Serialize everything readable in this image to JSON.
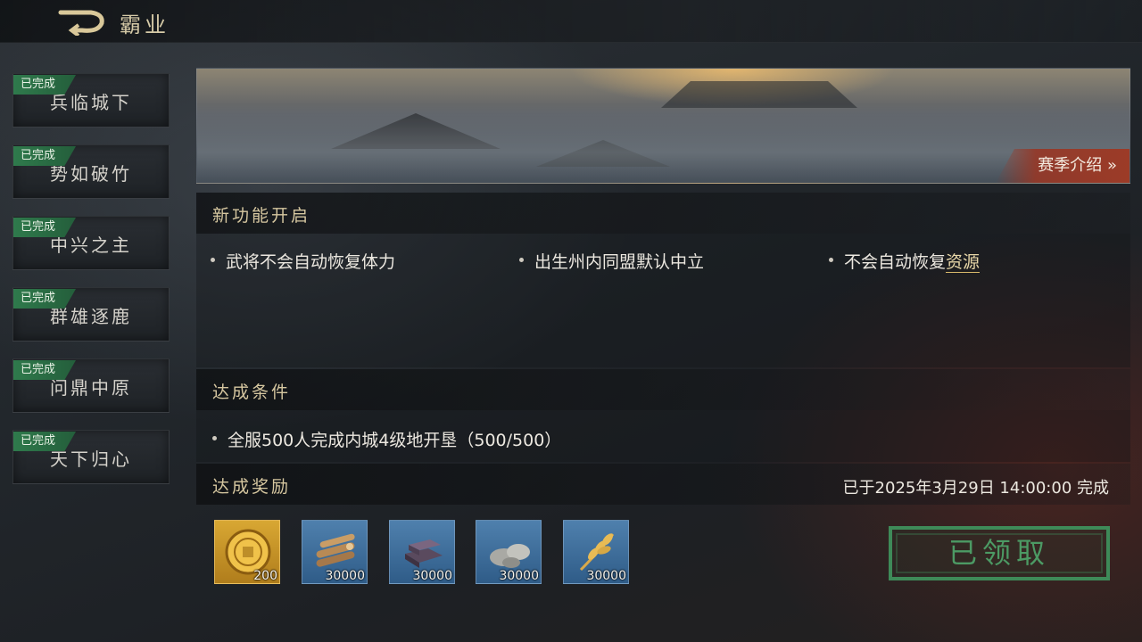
{
  "header": {
    "title": "霸业"
  },
  "sidebar": {
    "items": [
      {
        "label": "兵临城下",
        "badge": "已完成"
      },
      {
        "label": "势如破竹",
        "badge": "已完成"
      },
      {
        "label": "中兴之主",
        "badge": "已完成"
      },
      {
        "label": "群雄逐鹿",
        "badge": "已完成"
      },
      {
        "label": "问鼎中原",
        "badge": "已完成"
      },
      {
        "label": "天下归心",
        "badge": "已完成"
      }
    ]
  },
  "banner": {
    "season_button": "赛季介绍 »"
  },
  "features": {
    "title": "新功能开启",
    "items": [
      "武将不会自动恢复体力",
      "出生州内同盟默认中立",
      "不会自动恢复"
    ],
    "link_text": "资源"
  },
  "conditions": {
    "title": "达成条件",
    "items": [
      "全服500人完成内城4级地开垦（500/500）"
    ]
  },
  "rewards": {
    "title": "达成奖励",
    "completed_text": "已于2025年3月29日 14:00:00 完成",
    "items": [
      {
        "icon": "gold-coin-icon",
        "qty": "200"
      },
      {
        "icon": "wood-icon",
        "qty": "30000"
      },
      {
        "icon": "iron-icon",
        "qty": "30000"
      },
      {
        "icon": "stone-icon",
        "qty": "30000"
      },
      {
        "icon": "grain-icon",
        "qty": "30000"
      }
    ],
    "claim_status": "已领取"
  },
  "colors": {
    "accent_gold": "#d6c7a0",
    "badge_green": "#2f7a4c",
    "claimed_green": "#4c9a64",
    "season_red": "#9c3b27"
  }
}
